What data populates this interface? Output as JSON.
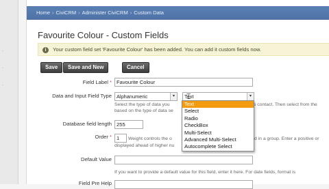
{
  "breadcrumb": [
    "Home",
    "CiviCRM",
    "Administer CiviCRM",
    "Custom Data"
  ],
  "page": {
    "title": "Favourite Colour - Custom Fields"
  },
  "notice": {
    "text": "Your custom field set 'Favourite Colour' has been added. You can add it custom fields now."
  },
  "buttons": {
    "save": "Save",
    "save_new": "Save and New",
    "cancel": "Cancel"
  },
  "form": {
    "field_label": {
      "label": "Field Label",
      "required": "*",
      "value": "Favourite Colour"
    },
    "data_type": {
      "label": "Data and Input Field Type",
      "data_value": "Alphanumeric",
      "input_value": "Text",
      "help1": "Select the type of data you",
      "help1_tail": "s contact. Then select from the",
      "help2": "based on the type of data se",
      "options": [
        "Text",
        "Select",
        "Radio",
        "CheckBox",
        "Multi-Select",
        "Advanced Multi-Select",
        "Autocomplete Select"
      ]
    },
    "db_length": {
      "label": "Database field length",
      "value": "255"
    },
    "order": {
      "label": "Order",
      "required": "*",
      "value": "1",
      "help1": "Weight controls the o",
      "help1_tail": "d in a group. Enter a positive or",
      "help2": "displayed ahead of higher nu"
    },
    "default_value": {
      "label": "Default Value",
      "help": "If you want to provide a default value for this field, enter it here. For date fields, format is"
    },
    "field_pre_help": {
      "label": "Field Pre Help"
    }
  },
  "colors": {
    "accent": "#f39c12",
    "breadcrumb_bg": "#5a7fb3",
    "button_bg": "#4a4a4a"
  }
}
